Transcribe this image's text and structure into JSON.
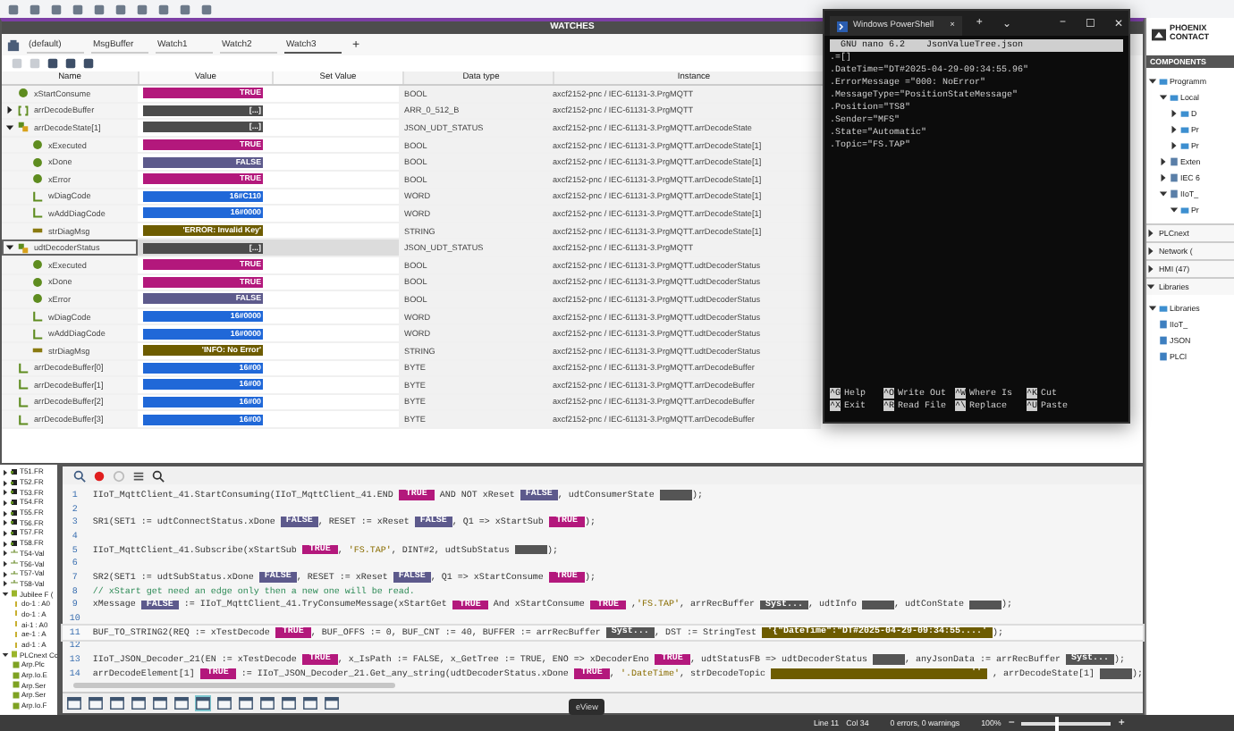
{
  "logo": {
    "line1": "PHOENIX",
    "line2": "CONTACT"
  },
  "watches": {
    "title": "WATCHES",
    "tabs": [
      {
        "label": "(default)",
        "selected": false
      },
      {
        "label": "MsgBuffer",
        "selected": false
      },
      {
        "label": "Watch1",
        "selected": false
      },
      {
        "label": "Watch2",
        "selected": false
      },
      {
        "label": "Watch3",
        "selected": true
      }
    ],
    "add_tab": "+",
    "columns": [
      "Name",
      "Value",
      "Set Value",
      "Data type",
      "Instance"
    ],
    "rows": [
      {
        "name": "xStartConsume",
        "kind": "bool",
        "value": {
          "kind": "true",
          "text": "TRUE"
        },
        "type": "BOOL",
        "instance": "axcf2152-pnc / IEC-61131-3.PrgMQTT",
        "selected": false
      },
      {
        "name": "arrDecodeBuffer",
        "kind": "array",
        "value": {
          "kind": "struct",
          "text": "[...]"
        },
        "type": "ARR_0_512_B",
        "instance": "axcf2152-pnc / IEC-61131-3.PrgMQTT",
        "selected": false,
        "expanded": false
      },
      {
        "name": "arrDecodeState[1]",
        "kind": "struct",
        "value": {
          "kind": "struct",
          "text": "[...]"
        },
        "type": "JSON_UDT_STATUS",
        "instance": "axcf2152-pnc / IEC-61131-3.PrgMQTT.arrDecodeState",
        "selected": false,
        "expanded": true,
        "children": [
          {
            "name": "xExecuted",
            "kind": "bool",
            "value": {
              "kind": "true",
              "text": "TRUE"
            },
            "type": "BOOL",
            "instance": "axcf2152-pnc / IEC-61131-3.PrgMQTT.arrDecodeState[1]",
            "selected": false
          },
          {
            "name": "xDone",
            "kind": "bool",
            "value": {
              "kind": "false",
              "text": "FALSE"
            },
            "type": "BOOL",
            "instance": "axcf2152-pnc / IEC-61131-3.PrgMQTT.arrDecodeState[1]",
            "selected": false
          },
          {
            "name": "xError",
            "kind": "bool",
            "value": {
              "kind": "true",
              "text": "TRUE"
            },
            "type": "BOOL",
            "instance": "axcf2152-pnc / IEC-61131-3.PrgMQTT.arrDecodeState[1]",
            "selected": false
          },
          {
            "name": "wDiagCode",
            "kind": "word",
            "value": {
              "kind": "number",
              "text": "16#C110"
            },
            "type": "WORD",
            "instance": "axcf2152-pnc / IEC-61131-3.PrgMQTT.arrDecodeState[1]",
            "selected": false
          },
          {
            "name": "wAddDiagCode",
            "kind": "word",
            "value": {
              "kind": "number",
              "text": "16#0000"
            },
            "type": "WORD",
            "instance": "axcf2152-pnc / IEC-61131-3.PrgMQTT.arrDecodeState[1]",
            "selected": false
          },
          {
            "name": "strDiagMsg",
            "kind": "string",
            "value": {
              "kind": "string",
              "text": "'ERROR: Invalid Key'"
            },
            "type": "STRING",
            "instance": "axcf2152-pnc / IEC-61131-3.PrgMQTT.arrDecodeState[1]",
            "selected": false
          }
        ]
      },
      {
        "name": "udtDecoderStatus",
        "kind": "struct",
        "value": {
          "kind": "struct",
          "text": "[...]"
        },
        "type": "JSON_UDT_STATUS",
        "instance": "axcf2152-pnc / IEC-61131-3.PrgMQTT",
        "selected": true,
        "expanded": true,
        "children": [
          {
            "name": "xExecuted",
            "kind": "bool",
            "value": {
              "kind": "true",
              "text": "TRUE"
            },
            "type": "BOOL",
            "instance": "axcf2152-pnc / IEC-61131-3.PrgMQTT.udtDecoderStatus",
            "selected": false
          },
          {
            "name": "xDone",
            "kind": "bool",
            "value": {
              "kind": "true",
              "text": "TRUE"
            },
            "type": "BOOL",
            "instance": "axcf2152-pnc / IEC-61131-3.PrgMQTT.udtDecoderStatus",
            "selected": false
          },
          {
            "name": "xError",
            "kind": "bool",
            "value": {
              "kind": "false",
              "text": "FALSE"
            },
            "type": "BOOL",
            "instance": "axcf2152-pnc / IEC-61131-3.PrgMQTT.udtDecoderStatus",
            "selected": false
          },
          {
            "name": "wDiagCode",
            "kind": "word",
            "value": {
              "kind": "number",
              "text": "16#0000"
            },
            "type": "WORD",
            "instance": "axcf2152-pnc / IEC-61131-3.PrgMQTT.udtDecoderStatus",
            "selected": false
          },
          {
            "name": "wAddDiagCode",
            "kind": "word",
            "value": {
              "kind": "number",
              "text": "16#0000"
            },
            "type": "WORD",
            "instance": "axcf2152-pnc / IEC-61131-3.PrgMQTT.udtDecoderStatus",
            "selected": false
          },
          {
            "name": "strDiagMsg",
            "kind": "string",
            "value": {
              "kind": "string",
              "text": "'INFO: No Error'"
            },
            "type": "STRING",
            "instance": "axcf2152-pnc / IEC-61131-3.PrgMQTT.udtDecoderStatus",
            "selected": false
          }
        ]
      },
      {
        "name": "arrDecodeBuffer[0]",
        "kind": "word",
        "value": {
          "kind": "number",
          "text": "16#00"
        },
        "type": "BYTE",
        "instance": "axcf2152-pnc / IEC-61131-3.PrgMQTT.arrDecodeBuffer",
        "selected": false
      },
      {
        "name": "arrDecodeBuffer[1]",
        "kind": "word",
        "value": {
          "kind": "number",
          "text": "16#00"
        },
        "type": "BYTE",
        "instance": "axcf2152-pnc / IEC-61131-3.PrgMQTT.arrDecodeBuffer",
        "selected": false
      },
      {
        "name": "arrDecodeBuffer[2]",
        "kind": "word",
        "value": {
          "kind": "number",
          "text": "16#00"
        },
        "type": "BYTE",
        "instance": "axcf2152-pnc / IEC-61131-3.PrgMQTT.arrDecodeBuffer",
        "selected": false
      },
      {
        "name": "arrDecodeBuffer[3]",
        "kind": "word",
        "value": {
          "kind": "number",
          "text": "16#00"
        },
        "type": "BYTE",
        "instance": "axcf2152-pnc / IEC-61131-3.PrgMQTT.arrDecodeBuffer",
        "selected": false
      }
    ]
  },
  "left_tree": [
    {
      "label": "T51.FR",
      "kind": "fr",
      "expanded": false
    },
    {
      "label": "T52.FR",
      "kind": "fr",
      "expanded": false
    },
    {
      "label": "T53.FR",
      "kind": "fr",
      "expanded": false
    },
    {
      "label": "T54.FR",
      "kind": "fr",
      "expanded": false
    },
    {
      "label": "T55.FR",
      "kind": "fr",
      "expanded": false
    },
    {
      "label": "T56.FR",
      "kind": "fr",
      "expanded": false
    },
    {
      "label": "T57.FR",
      "kind": "fr",
      "expanded": false
    },
    {
      "label": "T58.FR",
      "kind": "fr",
      "expanded": false
    },
    {
      "label": "T54-Val",
      "kind": "val",
      "expanded": false
    },
    {
      "label": "T56-Val",
      "kind": "val",
      "expanded": false
    },
    {
      "label": "T57-Val",
      "kind": "val",
      "expanded": false
    },
    {
      "label": "T58-Val",
      "kind": "val",
      "expanded": false
    },
    {
      "label": "Jubilee F (",
      "kind": "module",
      "expanded": true,
      "children": [
        {
          "label": "do-1 : A0",
          "kind": "io"
        },
        {
          "label": "do-1 : A",
          "kind": "io"
        },
        {
          "label": "ai-1 : A0",
          "kind": "io"
        },
        {
          "label": "ae-1 : A",
          "kind": "io"
        },
        {
          "label": "ad-1 : A",
          "kind": "io"
        }
      ]
    },
    {
      "label": "PLCnext Cc",
      "kind": "module",
      "expanded": true,
      "children": [
        {
          "label": "Arp.Plc",
          "kind": "app"
        },
        {
          "label": "Arp.Io.E",
          "kind": "app"
        },
        {
          "label": "Arp.Ser",
          "kind": "app"
        },
        {
          "label": "Arp.Ser",
          "kind": "app"
        },
        {
          "label": "Arp.Io.F",
          "kind": "app"
        }
      ]
    }
  ],
  "code_lines": [
    {
      "number": "1",
      "current": false,
      "segments": [
        {
          "kind": "code",
          "text": "IIoT_MqttClient_41.StartConsuming(IIoT_MqttClient_41.END "
        },
        {
          "kind": "true",
          "text": "TRUE"
        },
        {
          "kind": "code",
          "text": " AND NOT xReset "
        },
        {
          "kind": "false",
          "text": "FALSE"
        },
        {
          "kind": "code",
          "text": ", udtConsumerState "
        },
        {
          "kind": "blank"
        },
        {
          "kind": "code",
          "text": ");"
        }
      ]
    },
    {
      "number": "2",
      "current": false
    },
    {
      "number": "3",
      "current": false,
      "segments": [
        {
          "kind": "code",
          "text": "SR1(SET1 := udtConnectStatus.xDone "
        },
        {
          "kind": "false",
          "text": "FALSE"
        },
        {
          "kind": "code",
          "text": ", RESET := xReset "
        },
        {
          "kind": "false",
          "text": "FALSE"
        },
        {
          "kind": "code",
          "text": ", Q1 => xStartSub "
        },
        {
          "kind": "true",
          "text": "TRUE"
        },
        {
          "kind": "code",
          "text": ");"
        }
      ]
    },
    {
      "number": "4",
      "current": false
    },
    {
      "number": "5",
      "current": false,
      "segments": [
        {
          "kind": "code",
          "text": "IIoT_MqttClient_41.Subscribe(xStartSub "
        },
        {
          "kind": "true",
          "text": "TRUE"
        },
        {
          "kind": "code",
          "text": ", "
        },
        {
          "kind": "literal",
          "text": "'FS.TAP'"
        },
        {
          "kind": "code",
          "text": ", DINT#2, udtSubStatus "
        },
        {
          "kind": "blank"
        },
        {
          "kind": "code",
          "text": ");"
        }
      ]
    },
    {
      "number": "6",
      "current": false
    },
    {
      "number": "7",
      "current": false,
      "segments": [
        {
          "kind": "code",
          "text": "SR2(SET1 := udtSubStatus.xDone "
        },
        {
          "kind": "false",
          "text": "FALSE"
        },
        {
          "kind": "code",
          "text": ", RESET := xReset "
        },
        {
          "kind": "false",
          "text": "FALSE"
        },
        {
          "kind": "code",
          "text": ", Q1 => xStartConsume "
        },
        {
          "kind": "true",
          "text": "TRUE"
        },
        {
          "kind": "code",
          "text": ");"
        }
      ]
    },
    {
      "number": "8",
      "current": false,
      "segments": [
        {
          "kind": "comment",
          "text": "// xStart get need an edge only then a new one will be read."
        }
      ]
    },
    {
      "number": "9",
      "current": false,
      "segments": [
        {
          "kind": "code",
          "text": "xMessage "
        },
        {
          "kind": "false",
          "text": "FALSE"
        },
        {
          "kind": "code",
          "text": " := IIoT_MqttClient_41.TryConsumeMessage(xStartGet "
        },
        {
          "kind": "true",
          "text": "TRUE"
        },
        {
          "kind": "code",
          "text": " And xStartConsume "
        },
        {
          "kind": "true",
          "text": "TRUE"
        },
        {
          "kind": "code",
          "text": " ,"
        },
        {
          "kind": "literal",
          "text": "'FS.TAP'"
        },
        {
          "kind": "code",
          "text": ", arrRecBuffer "
        },
        {
          "kind": "value",
          "text": "Syst..."
        },
        {
          "kind": "code",
          "text": ", udtInfo "
        },
        {
          "kind": "blank"
        },
        {
          "kind": "code",
          "text": ", udtConState "
        },
        {
          "kind": "blank"
        },
        {
          "kind": "code",
          "text": ");"
        }
      ]
    },
    {
      "number": "10",
      "current": false
    },
    {
      "number": "11",
      "current": true,
      "segments": [
        {
          "kind": "code",
          "text": "BUF_TO_STRING2(REQ := xTestDecode "
        },
        {
          "kind": "true",
          "text": "TRUE"
        },
        {
          "kind": "code",
          "text": ", BUF_OFFS := 0, BUF_CNT := 40, BUFFER := arrRecBuffer "
        },
        {
          "kind": "value",
          "text": "Syst..."
        },
        {
          "kind": "code",
          "text": ", DST := StringTest "
        },
        {
          "kind": "string",
          "text": "'{\"DateTime\":\"DT#2025-04-29-09:34:55....'"
        },
        {
          "kind": "code",
          "text": ");"
        }
      ]
    },
    {
      "number": "12",
      "current": false
    },
    {
      "number": "13",
      "current": false,
      "segments": [
        {
          "kind": "code",
          "text": "IIoT_JSON_Decoder_21(EN := xTestDecode "
        },
        {
          "kind": "true",
          "text": "TRUE"
        },
        {
          "kind": "code",
          "text": ", x_IsPath := FALSE, x_GetTree := TRUE, ENO => xDecoderEno "
        },
        {
          "kind": "true",
          "text": "TRUE"
        },
        {
          "kind": "code",
          "text": ", udtStatusFB => udtDecoderStatus "
        },
        {
          "kind": "blank"
        },
        {
          "kind": "code",
          "text": ", anyJsonData := arrRecBuffer "
        },
        {
          "kind": "value",
          "text": "Syst..."
        },
        {
          "kind": "code",
          "text": ");"
        }
      ]
    },
    {
      "number": "14",
      "current": false,
      "segments": [
        {
          "kind": "code",
          "text": "arrDecodeElement[1] "
        },
        {
          "kind": "true",
          "text": "TRUE"
        },
        {
          "kind": "code",
          "text": " := IIoT_JSON_Decoder_21.Get_any_string(udtDecoderStatus.xDone "
        },
        {
          "kind": "true",
          "text": "TRUE"
        },
        {
          "kind": "code",
          "text": ", "
        },
        {
          "kind": "literal",
          "text": "'.DateTime'"
        },
        {
          "kind": "code",
          "text": ", strDecodeTopic "
        },
        {
          "kind": "string_wide",
          "text": "''"
        },
        {
          "kind": "code",
          "text": " , arrDecodeState[1] "
        },
        {
          "kind": "blank"
        },
        {
          "kind": "code",
          "text": ");"
        }
      ]
    }
  ],
  "tooltip": "eView",
  "status_bar": {
    "line": "Line 11",
    "col": "Col 34",
    "messages": "0 errors, 0 warnings",
    "zoom": "100%",
    "zoom_minus": "−",
    "zoom_plus": "+",
    "zoom_slider": {
      "level": 0.37
    }
  },
  "components": {
    "title": "COMPONENTS",
    "tree": [
      {
        "label": "Programm",
        "kind": "folder",
        "expanded": true,
        "children": [
          {
            "label": "Local",
            "kind": "folder",
            "expanded": true,
            "children": [
              {
                "label": "D",
                "kind": "folder",
                "expanded": false
              },
              {
                "label": "Pr",
                "kind": "folder",
                "expanded": false
              },
              {
                "label": "Pr",
                "kind": "folder",
                "expanded": false
              }
            ]
          },
          {
            "label": "Exten",
            "kind": "item",
            "expanded": false
          },
          {
            "label": "IEC 6",
            "kind": "item",
            "expanded": false
          },
          {
            "label": "IIoT_",
            "kind": "item",
            "expanded": true,
            "children": [
              {
                "label": "Pr",
                "kind": "folder",
                "expanded": true
              }
            ]
          }
        ]
      }
    ],
    "sections": [
      {
        "label": "PLCnext",
        "expanded": false
      },
      {
        "label": "Network (",
        "expanded": false
      },
      {
        "label": "HMI (47)",
        "expanded": false
      },
      {
        "label": "Libraries",
        "expanded": true
      }
    ],
    "libraries": [
      {
        "label": "Libraries",
        "kind": "folder",
        "expanded": true,
        "children": [
          {
            "label": "IIoT_",
            "kind": "item"
          },
          {
            "label": "JSON",
            "kind": "item"
          },
          {
            "label": "PLCl",
            "kind": "item"
          }
        ]
      }
    ]
  },
  "powershell": {
    "tab_title": "Windows PowerShell",
    "tab_close": "×",
    "new_tab": "+",
    "dropdown": "⌄",
    "minimize": "−",
    "maximize": "☐",
    "close": "✕",
    "nano_header": "  GNU nano 6.2    JsonValueTree.json",
    "lines": [
      ".=[]",
      ".DateTime=\"DT#2025-04-29-09:34:55.96\"",
      ".ErrorMessage =\"000: NoError\"",
      ".MessageType=\"PositionStateMessage\"",
      ".Position=\"TS8\"",
      ".Sender=\"MFS\"",
      ".State=\"Automatic\"",
      ".Topic=\"FS.TAP\""
    ],
    "shortcuts": [
      {
        "key": "^G",
        "label": "Help"
      },
      {
        "key": "^O",
        "label": "Write Out"
      },
      {
        "key": "^W",
        "label": "Where Is"
      },
      {
        "key": "^K",
        "label": "Cut"
      },
      {
        "key": "^X",
        "label": "Exit"
      },
      {
        "key": "^R",
        "label": "Read File"
      },
      {
        "key": "^\\",
        "label": "Replace"
      },
      {
        "key": "^U",
        "label": "Paste"
      }
    ]
  }
}
